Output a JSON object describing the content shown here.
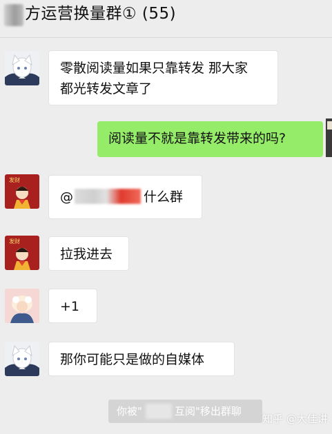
{
  "chat": {
    "title": "方运营换量群① (55)"
  },
  "messages": [
    {
      "lines": [
        "零散阅读量如果只靠转发 那大家",
        "都光转发文章了"
      ],
      "avatar": "cat-boy-avatar"
    },
    {
      "text": "阅读量不就是靠转发带来的吗?",
      "self": true
    },
    {
      "prefix": "@",
      "suffix": "什么群",
      "avatar": "lucky-red-avatar"
    },
    {
      "text": "拉我进去",
      "avatar": "lucky-red-avatar"
    },
    {
      "text": "+1",
      "avatar": "pink-girl-avatar"
    },
    {
      "text": "那你可能只是做的自媒体",
      "avatar": "cat-boy-avatar"
    }
  ],
  "system_notice": {
    "part1": "你被\"",
    "part2": "互阅\"移出群聊"
  },
  "watermark": "知乎 @大佳讲",
  "avatar_badge": "发财",
  "colors": {
    "background": "#ededed",
    "self_bubble": "#95ec69",
    "other_bubble": "#ffffff"
  }
}
